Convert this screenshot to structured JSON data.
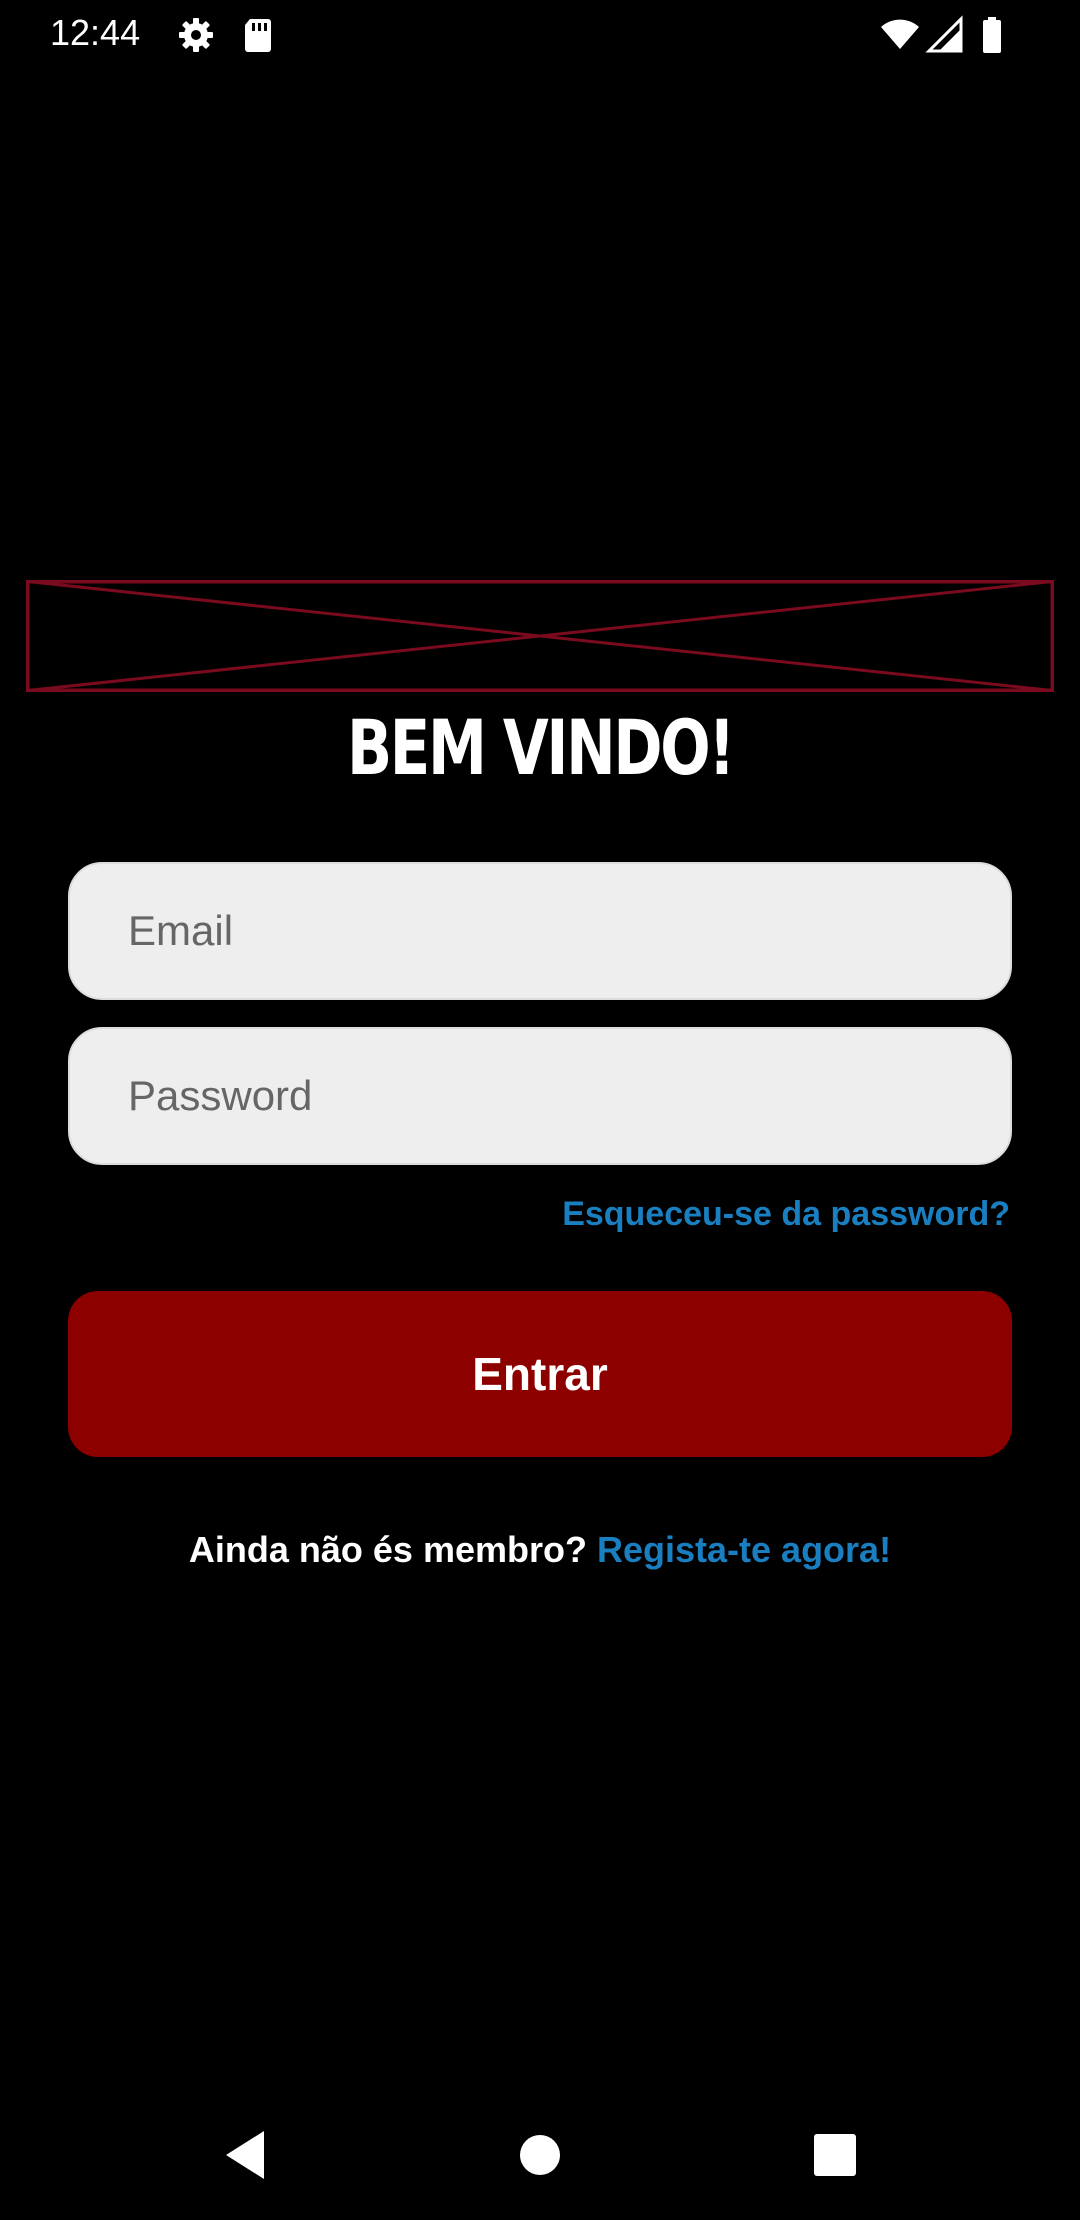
{
  "status_bar": {
    "time": "12:44",
    "icons": [
      "gear-icon",
      "sd-card-icon",
      "wifi-icon",
      "cell-signal-icon",
      "battery-icon"
    ]
  },
  "login": {
    "title": "BEM VINDO!",
    "email_placeholder": "Email",
    "password_placeholder": "Password",
    "forgot_password": "Esqueceu-se da password?",
    "submit_label": "Entrar",
    "register_prompt": "Ainda não és membro?",
    "register_link": "Regista-te agora!"
  },
  "nav_bar": {
    "icons": [
      "back-icon",
      "home-icon",
      "recents-icon"
    ]
  },
  "colors": {
    "background": "#000000",
    "accent": "#8c0000",
    "link": "#1a7fc1",
    "logo_placeholder": "#7a0a1e",
    "field": "#eeeeee"
  }
}
